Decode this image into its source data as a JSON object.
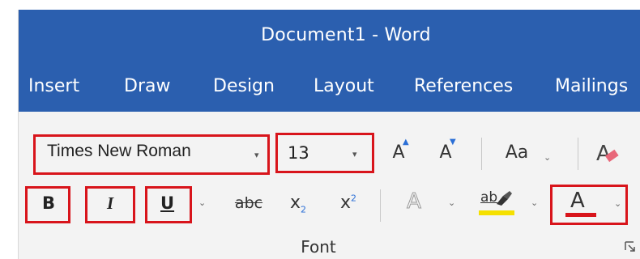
{
  "window": {
    "title": "Document1 - Word"
  },
  "tabs": [
    {
      "label": "Insert"
    },
    {
      "label": "Draw"
    },
    {
      "label": "Design"
    },
    {
      "label": "Layout"
    },
    {
      "label": "References"
    },
    {
      "label": "Mailings"
    }
  ],
  "font_group": {
    "font_name": "Times New Roman",
    "font_size": "13",
    "grow_font_glyph": "A",
    "shrink_font_glyph": "A",
    "change_case_label": "Aa",
    "bold_label": "B",
    "italic_label": "I",
    "underline_label": "U",
    "strikethrough_label": "abc",
    "subscript_label": "x",
    "subscript_mark": "2",
    "superscript_label": "x",
    "superscript_mark": "2",
    "text_effects_glyph": "A",
    "highlight_glyph": "ab",
    "font_color_glyph": "A",
    "group_label": "Font"
  },
  "colors": {
    "title_bar": "#2b5faf",
    "highlight": "#f5e000",
    "font_color": "#d8141b",
    "annotation_box": "#d8141b"
  }
}
